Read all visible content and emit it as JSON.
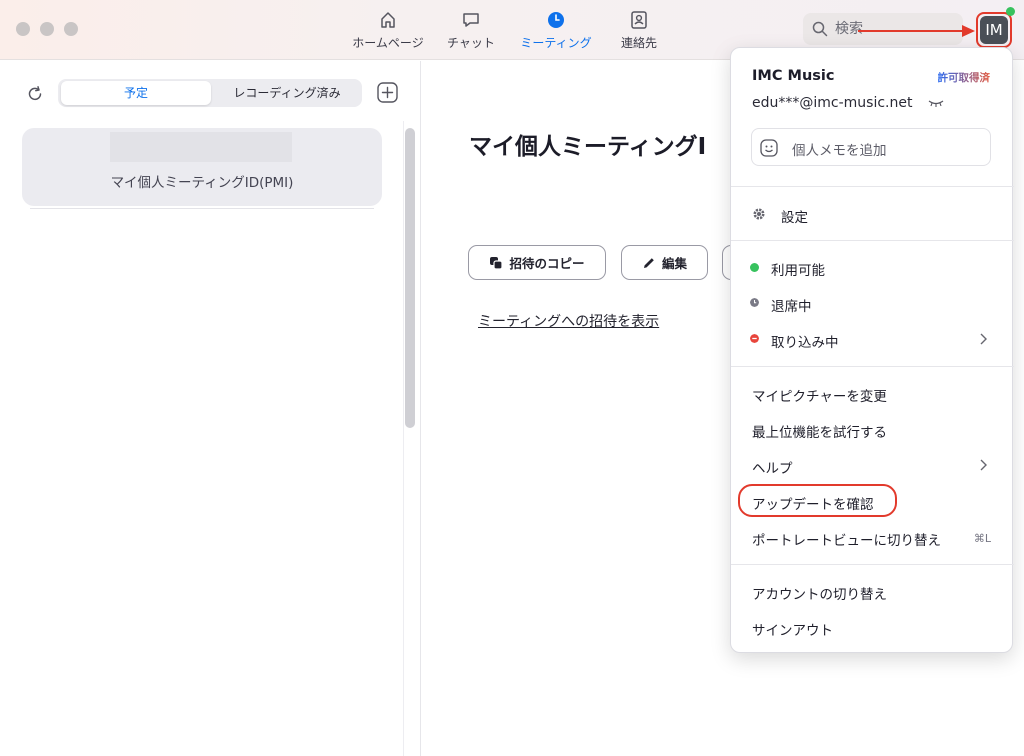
{
  "nav": {
    "tabs": [
      {
        "label": "ホームページ",
        "icon": "home-icon"
      },
      {
        "label": "チャット",
        "icon": "chat-icon"
      },
      {
        "label": "ミーティング",
        "icon": "clock-icon",
        "active": true
      },
      {
        "label": "連絡先",
        "icon": "contacts-icon"
      }
    ],
    "search_placeholder": "検索",
    "avatar_initials": "IM",
    "accent_color": "#0e71eb",
    "presence_color": "#37c25e"
  },
  "left": {
    "segments": [
      "予定",
      "レコーディング済み"
    ],
    "pmi_label": "マイ個人ミーティングID(PMI)"
  },
  "main": {
    "title": "マイ個人ミーティングI",
    "copy_invite_button": "招待のコピー",
    "edit_button": "編集",
    "show_invite_link": "ミーティングへの招待を表示"
  },
  "menu": {
    "account_name": "IMC Music",
    "license": "許可取得済",
    "email": "edu***@imc-music.net",
    "memo_placeholder": "個人メモを追加",
    "settings": "設定",
    "status": {
      "available": "利用可能",
      "away": "退席中",
      "busy": "取り込み中"
    },
    "change_picture": "マイピクチャーを変更",
    "try_premium": "最上位機能を試行する",
    "help": "ヘルプ",
    "check_updates": "アップデートを確認",
    "portrait_view": "ポートレートビューに切り替え",
    "portrait_shortcut": "⌘L",
    "switch_account": "アカウントの切り替え",
    "sign_out": "サインアウト"
  }
}
